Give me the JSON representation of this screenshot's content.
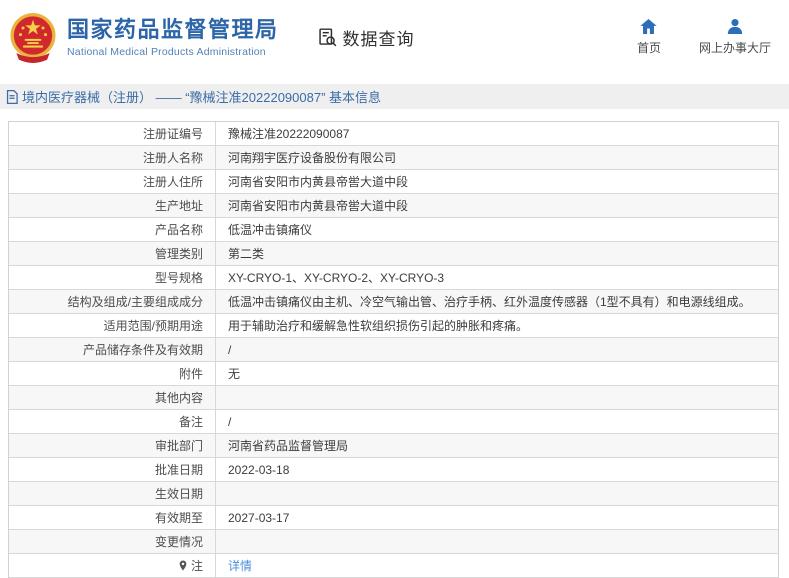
{
  "header": {
    "org_name_cn": "国家药品监督管理局",
    "org_name_en": "National Medical Products Administration",
    "section_title": "数据查询",
    "nav": [
      {
        "label": "首页",
        "icon": "home-icon"
      },
      {
        "label": "网上办事大厅",
        "icon": "person-icon"
      }
    ]
  },
  "breadcrumb": {
    "text": "境内医疗器械（注册） —— “豫械注准20222090087” 基本信息",
    "icon": "document-icon"
  },
  "table": {
    "rows": [
      {
        "label": "注册证编号",
        "value": "豫械注准20222090087"
      },
      {
        "label": "注册人名称",
        "value": "河南翔宇医疗设备股份有限公司"
      },
      {
        "label": "注册人住所",
        "value": "河南省安阳市内黄县帝喾大道中段"
      },
      {
        "label": "生产地址",
        "value": "河南省安阳市内黄县帝喾大道中段"
      },
      {
        "label": "产品名称",
        "value": "低温冲击镇痛仪"
      },
      {
        "label": "管理类别",
        "value": "第二类"
      },
      {
        "label": "型号规格",
        "value": "XY-CRYO-1、XY-CRYO-2、XY-CRYO-3"
      },
      {
        "label": "结构及组成/主要组成成分",
        "value": "低温冲击镇痛仪由主机、冷空气输出管、治疗手柄、红外温度传感器（1型不具有）和电源线组成。"
      },
      {
        "label": "适用范围/预期用途",
        "value": "用于辅助治疗和缓解急性软组织损伤引起的肿胀和疼痛。"
      },
      {
        "label": "产品储存条件及有效期",
        "value": "/"
      },
      {
        "label": "附件",
        "value": "无"
      },
      {
        "label": "其他内容",
        "value": ""
      },
      {
        "label": "备注",
        "value": "/"
      },
      {
        "label": "审批部门",
        "value": "河南省药品监督管理局"
      },
      {
        "label": "批准日期",
        "value": "2022-03-18"
      },
      {
        "label": "生效日期",
        "value": ""
      },
      {
        "label": "有效期至",
        "value": "2027-03-17"
      },
      {
        "label": "变更情况",
        "value": ""
      },
      {
        "label": "注",
        "value": "详情",
        "value_is_link": true,
        "label_icon": "note-pin-icon"
      }
    ]
  },
  "colors": {
    "brand_blue": "#2c66a8",
    "subtitle_blue": "#5580b5",
    "nav_icon_blue": "#2e6db8",
    "breadcrumb_blue": "#3a6ca8",
    "link_blue": "#4a90d9",
    "alt_row_bg": "#f7f7f7",
    "border": "#d8d8d8"
  }
}
